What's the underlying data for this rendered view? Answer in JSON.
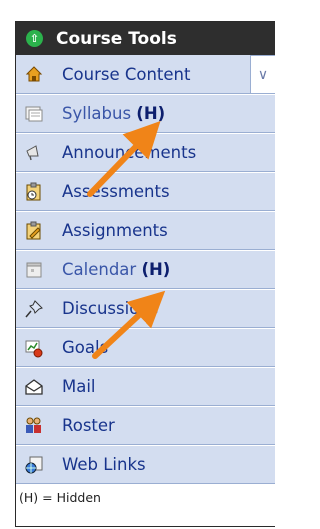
{
  "header": {
    "title": "Course Tools",
    "logo_icon": "green-circle-chevron-icon"
  },
  "items": [
    {
      "label": "Course Content",
      "icon": "folder-house-icon"
    },
    {
      "label": "Syllabus ",
      "hidden_mark": "(H)",
      "icon": "document-icon"
    },
    {
      "label": "Announcements",
      "icon": "megaphone-icon"
    },
    {
      "label": "Assessments",
      "icon": "clipboard-clock-icon"
    },
    {
      "label": "Assignments",
      "icon": "clipboard-pencil-icon"
    },
    {
      "label": "Calendar ",
      "hidden_mark": "(H)",
      "icon": "calendar-icon"
    },
    {
      "label": "Discussions",
      "icon": "pushpin-icon"
    },
    {
      "label": "Goals",
      "icon": "target-chart-icon"
    },
    {
      "label": "Mail",
      "icon": "envelope-icon"
    },
    {
      "label": "Roster",
      "icon": "people-icon"
    },
    {
      "label": "Web Links",
      "icon": "globe-document-icon"
    }
  ],
  "collapse_icon": "double-chevron-down-icon",
  "footer": {
    "legend": "(H) = Hidden"
  },
  "colors": {
    "header_bg": "#2e2e2e",
    "item_bg": "#d3ddf0",
    "link_text": "#18348c",
    "arrow": "#f08418"
  }
}
